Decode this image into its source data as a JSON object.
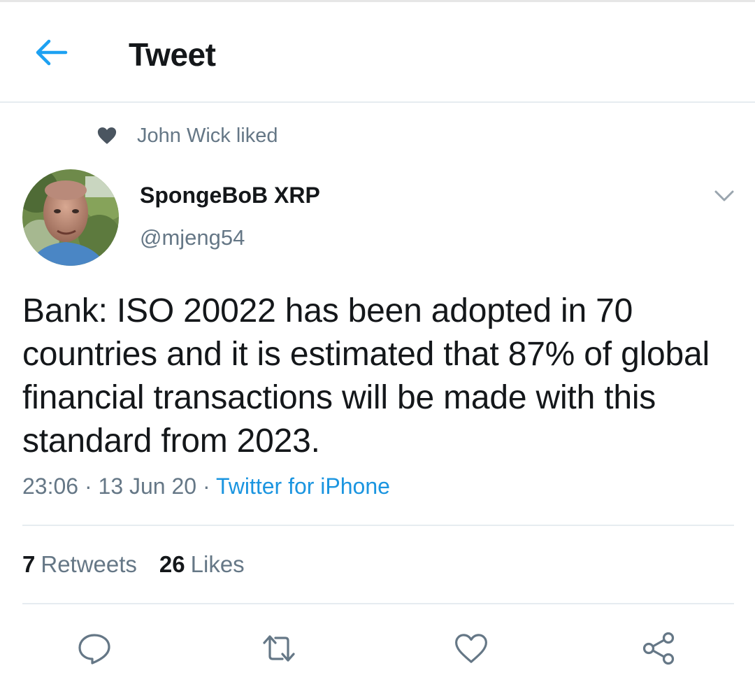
{
  "header": {
    "title": "Tweet",
    "back_icon": "arrow-left-icon"
  },
  "social_context": {
    "text": "John Wick liked",
    "icon": "heart-filled-icon"
  },
  "author": {
    "display_name": "SpongeBoB XRP",
    "handle": "@mjeng54"
  },
  "tweet": {
    "text": "Bank: ISO 20022 has been adopted in 70 countries and it is estimated that 87% of global financial transactions will be made with this standard from 2023.",
    "time": "23:06",
    "date": "13 Jun 20",
    "separator": "·",
    "source": "Twitter for iPhone"
  },
  "stats": {
    "retweets_count": "7",
    "retweets_label": "Retweets",
    "likes_count": "26",
    "likes_label": "Likes"
  },
  "actions": [
    "reply-icon",
    "retweet-icon",
    "like-icon",
    "share-icon"
  ],
  "colors": {
    "accent": "#1b95e0",
    "secondary_text": "#657786",
    "primary_text": "#14171a",
    "divider": "#e6ecf0"
  }
}
